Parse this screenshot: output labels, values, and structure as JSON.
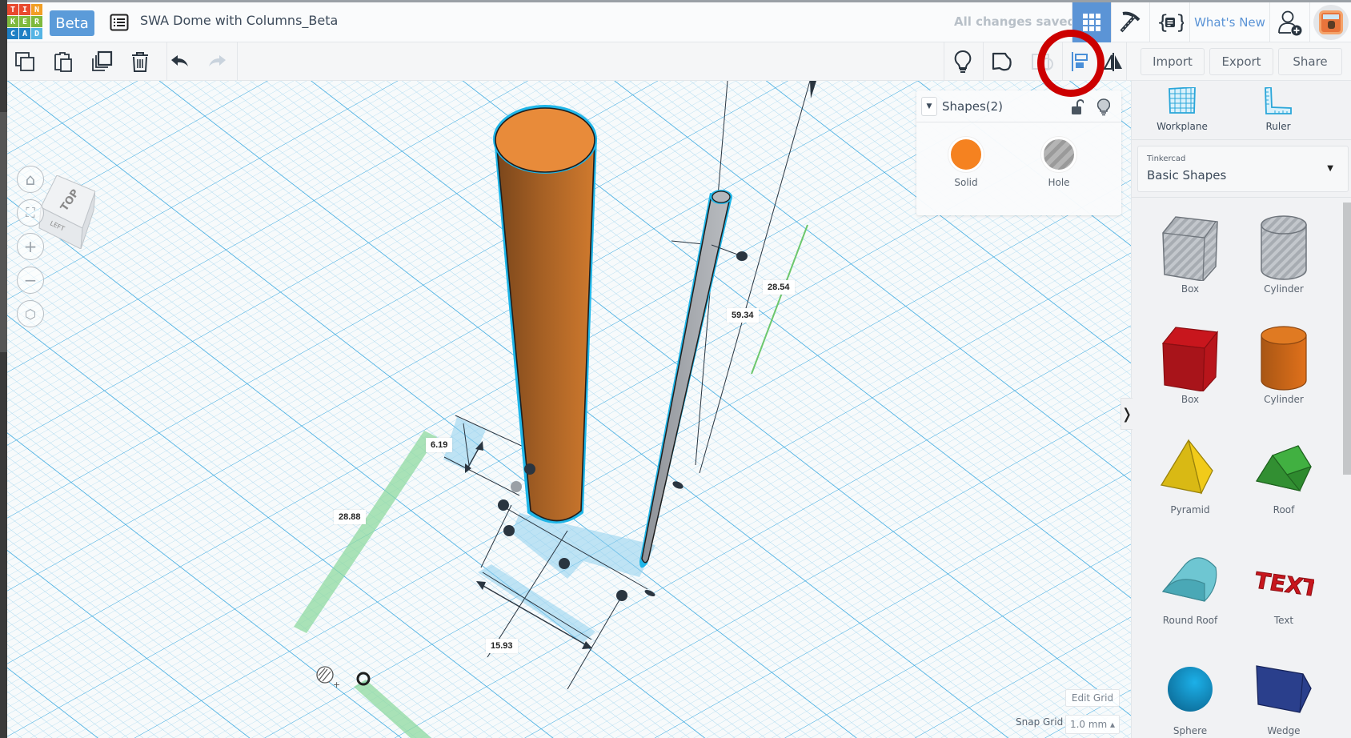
{
  "header": {
    "logo_letters": [
      "T",
      "I",
      "N",
      "K",
      "E",
      "R",
      "C",
      "A",
      "D"
    ],
    "beta_label": "Beta",
    "document_title": "SWA Dome with Columns_Beta",
    "save_status": "All changes saved",
    "whats_new_label": "What's New"
  },
  "toolbar": {
    "left_tools": [
      {
        "name": "copy",
        "icon": "copy-icon"
      },
      {
        "name": "paste",
        "icon": "paste-icon"
      },
      {
        "name": "duplicate",
        "icon": "duplicate-icon"
      },
      {
        "name": "delete",
        "icon": "trash-icon"
      },
      {
        "name": "undo",
        "icon": "undo-icon"
      },
      {
        "name": "redo",
        "icon": "redo-icon",
        "disabled": true
      }
    ],
    "right_tools": [
      {
        "name": "notes",
        "icon": "lightbulb-icon"
      },
      {
        "name": "workplane-shape",
        "icon": "shape-outline-icon"
      },
      {
        "name": "view",
        "icon": "camera-icon",
        "disabled": true
      },
      {
        "name": "align",
        "icon": "align-icon",
        "highlighted": true
      },
      {
        "name": "mirror",
        "icon": "mirror-icon"
      }
    ],
    "import_label": "Import",
    "export_label": "Export",
    "share_label": "Share"
  },
  "viewcube": {
    "top_label": "TOP",
    "left_label": "LEFT"
  },
  "view_controls": [
    {
      "name": "home",
      "glyph": "⌂"
    },
    {
      "name": "fit",
      "glyph": "⛶"
    },
    {
      "name": "zoom-in",
      "glyph": "+"
    },
    {
      "name": "zoom-out",
      "glyph": "−"
    },
    {
      "name": "perspective",
      "glyph": "⬡"
    }
  ],
  "dimensions": {
    "width_label": "6.19",
    "length_left_label": "28.88",
    "height_label": "59.34",
    "length_right_label": "28.54",
    "depth_label": "15.93"
  },
  "inspector": {
    "title": "Shapes(2)",
    "solid_label": "Solid",
    "hole_label": "Hole",
    "solid_color": "#f58220",
    "hole_color": "#b0b0b0"
  },
  "right_panel": {
    "workplane_label": "Workplane",
    "ruler_label": "Ruler",
    "library_source": "Tinkercad",
    "library_name": "Basic Shapes",
    "shapes": [
      {
        "label": "Box",
        "kind": "box-hole"
      },
      {
        "label": "Cylinder",
        "kind": "cylinder-hole"
      },
      {
        "label": "Box",
        "kind": "box",
        "color": "#c8161d"
      },
      {
        "label": "Cylinder",
        "kind": "cylinder",
        "color": "#e0711b"
      },
      {
        "label": "Pyramid",
        "kind": "pyramid",
        "color": "#f1cb1a"
      },
      {
        "label": "Roof",
        "kind": "roof",
        "color": "#3aa83a"
      },
      {
        "label": "Round Roof",
        "kind": "round-roof",
        "color": "#5fbfcc"
      },
      {
        "label": "Text",
        "kind": "text",
        "color": "#c8161d"
      },
      {
        "label": "Sphere",
        "kind": "sphere",
        "color": "#1a9fd6"
      },
      {
        "label": "Wedge",
        "kind": "wedge",
        "color": "#2a3f8c"
      }
    ]
  },
  "grid": {
    "edit_grid_label": "Edit Grid",
    "snap_grid_label": "Snap Grid",
    "snap_grid_value": "1.0 mm ▴"
  },
  "colors": {
    "accent": "#5b94d6",
    "selection_outline": "#1fb6e8",
    "annotation": "#cc0000",
    "grid_line": "#9fd3ee"
  }
}
